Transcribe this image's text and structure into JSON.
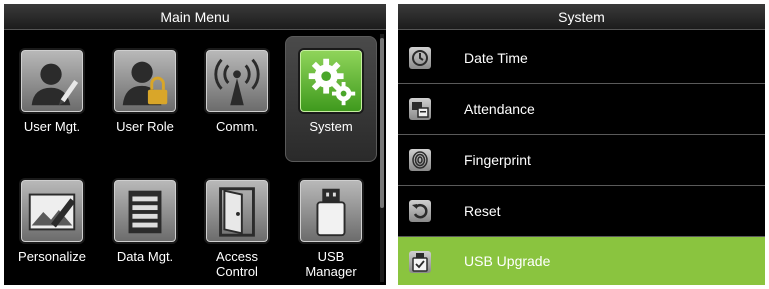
{
  "main_menu": {
    "title": "Main Menu",
    "items": [
      {
        "label": "User Mgt.",
        "icon": "user-edit-icon"
      },
      {
        "label": "User Role",
        "icon": "user-lock-icon"
      },
      {
        "label": "Comm.",
        "icon": "antenna-icon"
      },
      {
        "label": "System",
        "icon": "gears-icon",
        "selected": true
      },
      {
        "label": "Personalize",
        "icon": "pencil-picture-icon"
      },
      {
        "label": "Data Mgt.",
        "icon": "server-icon"
      },
      {
        "label": "Access\nControl",
        "icon": "door-icon"
      },
      {
        "label": "USB\nManager",
        "icon": "usb-drive-icon"
      }
    ]
  },
  "system_menu": {
    "title": "System",
    "items": [
      {
        "label": "Date Time",
        "icon": "clock-icon"
      },
      {
        "label": "Attendance",
        "icon": "attendance-icon"
      },
      {
        "label": "Fingerprint",
        "icon": "fingerprint-icon"
      },
      {
        "label": "Reset",
        "icon": "reset-icon"
      },
      {
        "label": "USB Upgrade",
        "icon": "usb-upgrade-icon",
        "selected": true
      }
    ]
  },
  "colors": {
    "screen_bg": "#000000",
    "selected_green": "#8ac43f",
    "selected_icon_green": "#4aa62a",
    "icon_gray": "#9a9a9a"
  }
}
